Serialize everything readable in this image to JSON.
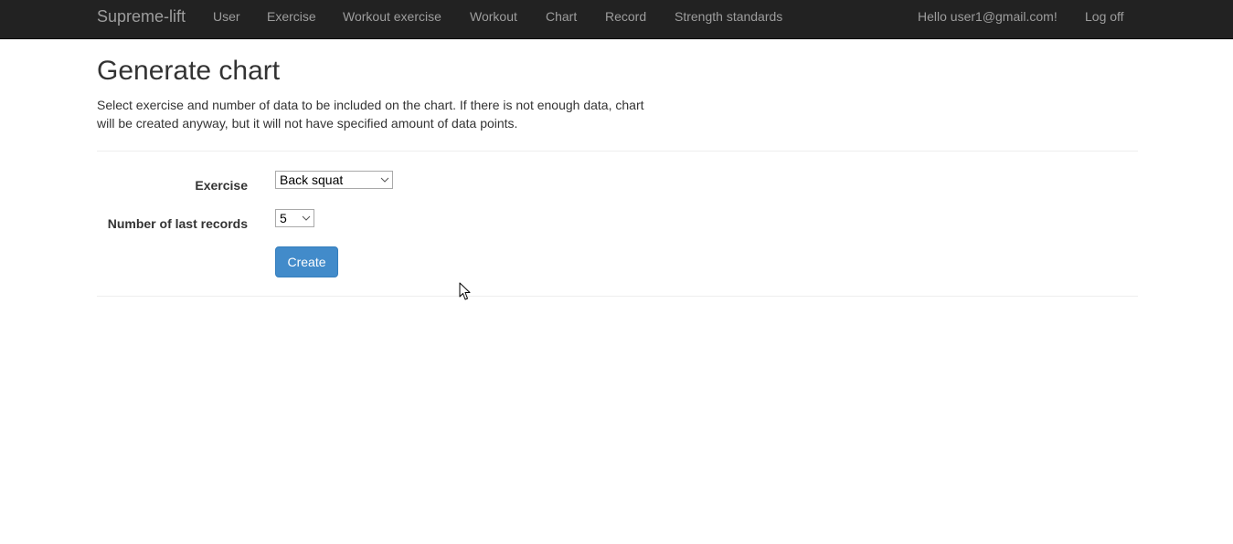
{
  "navbar": {
    "brand": "Supreme-lift",
    "items": [
      {
        "label": "User"
      },
      {
        "label": "Exercise"
      },
      {
        "label": "Workout exercise"
      },
      {
        "label": "Workout"
      },
      {
        "label": "Chart"
      },
      {
        "label": "Record"
      },
      {
        "label": "Strength standards"
      }
    ],
    "greeting": "Hello user1@gmail.com!",
    "logoff": "Log off"
  },
  "page": {
    "title": "Generate chart",
    "intro": "Select exercise and number of data to be included on the chart. If there is not enough data, chart will be created anyway, but it will not have specified amount of data points."
  },
  "form": {
    "exercise_label": "Exercise",
    "exercise_value": "Back squat",
    "records_label": "Number of last records",
    "records_value": "5",
    "create_label": "Create"
  },
  "colors": {
    "navbar_bg": "#222222",
    "navbar_text": "#9d9d9d",
    "primary": "#428bca"
  },
  "icons": {
    "select_chevron": "chevron-down-icon",
    "cursor": "mouse-pointer-icon"
  }
}
